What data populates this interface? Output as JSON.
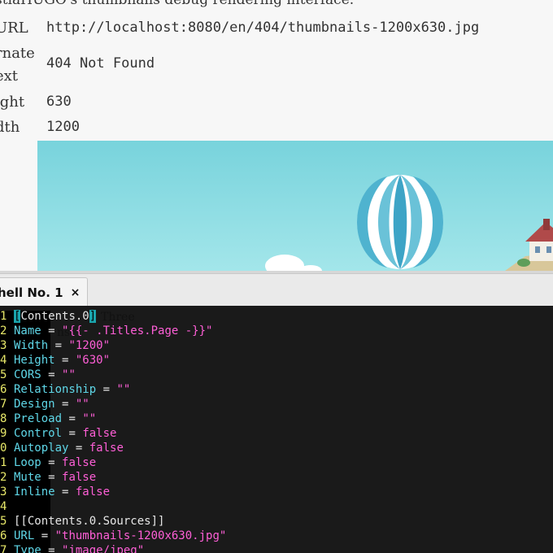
{
  "browser": {
    "intro_text": "stiaHUGO's thumbnails debug rendering interface.",
    "rows": [
      {
        "label": "URL",
        "value": "http://localhost:8080/en/404/thumbnails-1200x630.jpg"
      },
      {
        "label": "rnate",
        "label2": "ext",
        "value": "404 Not Found"
      },
      {
        "label": "ight",
        "value": "630"
      },
      {
        "label": "dth",
        "value": "1200"
      }
    ]
  },
  "terminal": {
    "tab_title": "hell No. 1",
    "tab_close": "×",
    "overlay_lines": [
      "Three",
      "ns"
    ],
    "lines": [
      {
        "num": "1",
        "parts": [
          [
            "cursor",
            "["
          ],
          [
            "plain",
            "Contents.0"
          ],
          [
            "cursor",
            "]"
          ]
        ]
      },
      {
        "num": "2",
        "parts": [
          [
            "key",
            "Name"
          ],
          [
            "op",
            " = "
          ],
          [
            "str",
            "\"{{- .Titles.Page -}}\""
          ]
        ]
      },
      {
        "num": "3",
        "parts": [
          [
            "key",
            "Width"
          ],
          [
            "op",
            " = "
          ],
          [
            "str",
            "\"1200\""
          ]
        ]
      },
      {
        "num": "4",
        "parts": [
          [
            "key",
            "Height"
          ],
          [
            "op",
            " = "
          ],
          [
            "str",
            "\"630\""
          ]
        ]
      },
      {
        "num": "5",
        "parts": [
          [
            "key",
            "CORS"
          ],
          [
            "op",
            " = "
          ],
          [
            "str",
            "\"\""
          ]
        ]
      },
      {
        "num": "6",
        "parts": [
          [
            "key",
            "Relationship"
          ],
          [
            "op",
            " = "
          ],
          [
            "str",
            "\"\""
          ]
        ]
      },
      {
        "num": "7",
        "parts": [
          [
            "key",
            "Design"
          ],
          [
            "op",
            " = "
          ],
          [
            "str",
            "\"\""
          ]
        ]
      },
      {
        "num": "8",
        "parts": [
          [
            "key",
            "Preload"
          ],
          [
            "op",
            " = "
          ],
          [
            "str",
            "\"\""
          ]
        ]
      },
      {
        "num": "9",
        "parts": [
          [
            "key",
            "Control"
          ],
          [
            "op",
            " = "
          ],
          [
            "bool",
            "false"
          ]
        ]
      },
      {
        "num": "0",
        "parts": [
          [
            "key",
            "Autoplay"
          ],
          [
            "op",
            " = "
          ],
          [
            "bool",
            "false"
          ]
        ]
      },
      {
        "num": "1",
        "parts": [
          [
            "key",
            "Loop"
          ],
          [
            "op",
            " = "
          ],
          [
            "bool",
            "false"
          ]
        ]
      },
      {
        "num": "2",
        "parts": [
          [
            "key",
            "Mute"
          ],
          [
            "op",
            " = "
          ],
          [
            "bool",
            "false"
          ]
        ]
      },
      {
        "num": "3",
        "parts": [
          [
            "key",
            "Inline"
          ],
          [
            "op",
            " = "
          ],
          [
            "bool",
            "false"
          ]
        ]
      },
      {
        "num": "4",
        "parts": []
      },
      {
        "num": "5",
        "parts": [
          [
            "plain",
            "[[Contents.0.Sources]]"
          ]
        ]
      },
      {
        "num": "6",
        "parts": [
          [
            "key",
            "URL"
          ],
          [
            "op",
            " = "
          ],
          [
            "str",
            "\"thumbnails-1200x630.jpg\""
          ]
        ]
      },
      {
        "num": "7",
        "parts": [
          [
            "key",
            "Type"
          ],
          [
            "op",
            " = "
          ],
          [
            "str",
            "\"image/jpeg\""
          ]
        ]
      }
    ]
  }
}
